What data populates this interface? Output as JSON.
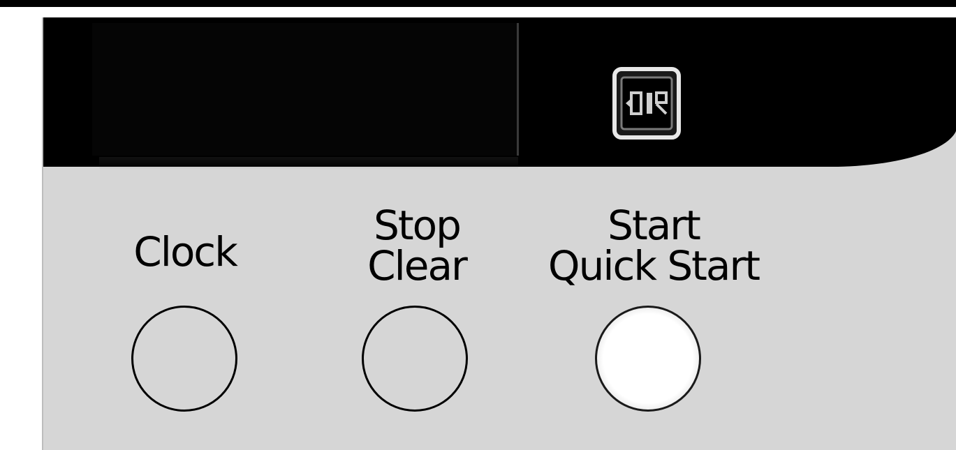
{
  "panel": {
    "buttons": [
      {
        "line1": "",
        "line2": "Clock",
        "lit": false
      },
      {
        "line1": "Stop",
        "line2": "Clear",
        "lit": false
      },
      {
        "line1": "Start",
        "line2": "Quick Start",
        "lit": true
      }
    ],
    "display_icon": "display-indicator-icon",
    "colors": {
      "panel": "#d6d6d6",
      "display": "#000000",
      "text": "#000000",
      "button_lit": "#ffffff"
    }
  }
}
